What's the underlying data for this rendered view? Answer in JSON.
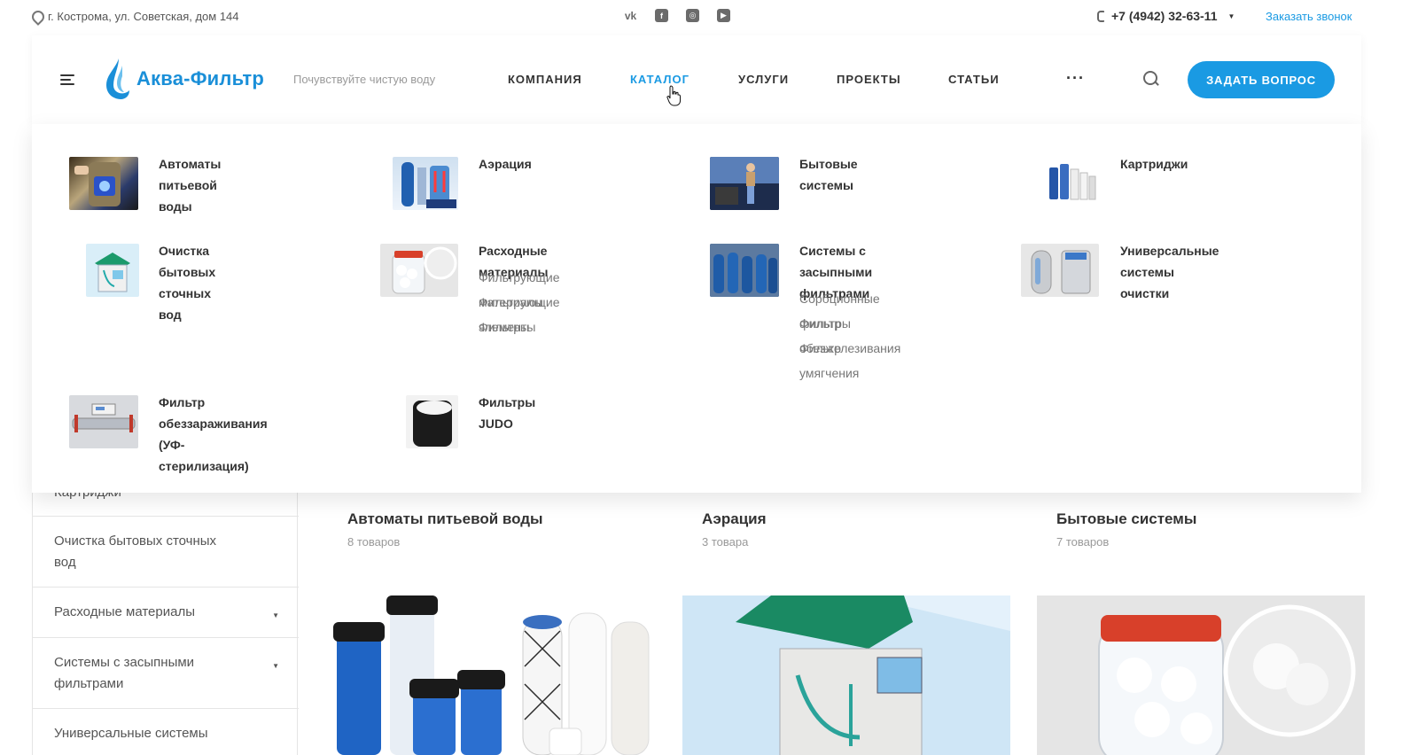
{
  "topbar": {
    "address": "г. Кострома, ул. Советская, дом 144",
    "socials": [
      "vk-icon",
      "facebook-icon",
      "instagram-icon",
      "youtube-icon"
    ],
    "phone": "+7 (4942) 32-63-11",
    "callback": "Заказать звонок"
  },
  "header": {
    "logo": "Аква-Фильтр",
    "slogan": "Почувствуйте чистую воду",
    "nav": [
      {
        "label": "КОМПАНИЯ",
        "active": false
      },
      {
        "label": "КАТАЛОГ",
        "active": true
      },
      {
        "label": "УСЛУГИ",
        "active": false
      },
      {
        "label": "ПРОЕКТЫ",
        "active": false
      },
      {
        "label": "СТАТЬИ",
        "active": false
      }
    ],
    "more": "···",
    "ask_button": "ЗАДАТЬ ВОПРОС"
  },
  "mega_menu": {
    "categories": [
      {
        "title": "Автоматы питьевой воды",
        "sub": []
      },
      {
        "title": "Аэрация",
        "sub": []
      },
      {
        "title": "Бытовые системы",
        "sub": []
      },
      {
        "title": "Картриджи",
        "sub": []
      },
      {
        "title_lines": [
          "Очистка бытовых сточных",
          "вод"
        ],
        "sub": []
      },
      {
        "title": "Расходные материалы",
        "sub": [
          "Фильтрующие материалы",
          "Фильтрующие элементы",
          "Фильтры"
        ]
      },
      {
        "title_lines": [
          "Системы с засыпными",
          "фильтрами"
        ],
        "sub": [
          "Сорбционные фильтры",
          "Фильтр обезжелезивания",
          "Фильтр умягчения"
        ]
      },
      {
        "title_lines": [
          "Универсальные системы",
          "очистки"
        ],
        "sub": []
      },
      {
        "title_lines": [
          "Фильтр обеззараживания",
          "(УФ-стерилизация)"
        ],
        "sub": []
      },
      {
        "title": "Фильтры JUDO",
        "sub": []
      }
    ]
  },
  "sidebar": {
    "items": [
      {
        "label": "Картриджи"
      },
      {
        "label_lines": [
          "Очистка бытовых сточных",
          "вод"
        ]
      },
      {
        "label": "Расходные материалы"
      },
      {
        "label_lines": [
          "Системы с засыпными",
          "фильтрами"
        ]
      },
      {
        "label": "Универсальные системы"
      }
    ]
  },
  "products": [
    {
      "title": "Автоматы питьевой воды",
      "count": "8 товаров"
    },
    {
      "title": "Аэрация",
      "count": "3 товара"
    },
    {
      "title": "Бытовые системы",
      "count": "7 товаров"
    }
  ],
  "colors": {
    "accent": "#1a9ae3",
    "text": "#333333",
    "muted": "#999999"
  }
}
